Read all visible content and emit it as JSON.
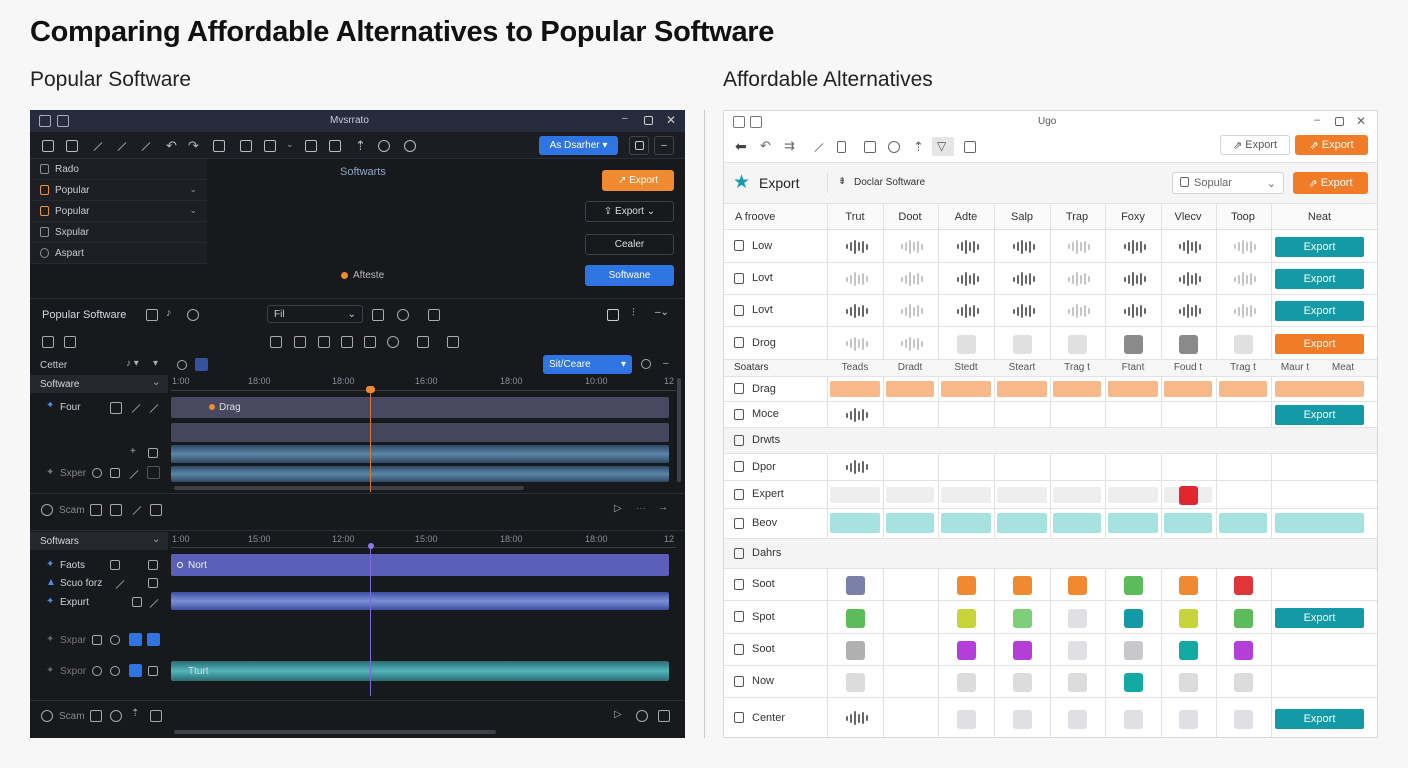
{
  "title": "Comparing Affordable Alternatives to Popular Software",
  "left_heading": "Popular Software",
  "right_heading": "Affordable Alternatives",
  "dark": {
    "window_title": "Mvsrrato",
    "toolbar_button": "As Dsarher",
    "menu": [
      "Rado",
      "Popular",
      "Popular",
      "Sxpular",
      "Aspart"
    ],
    "canvas_label": "Softwarts",
    "export1": "Export",
    "export2": "Export",
    "creater": "Cealer",
    "status_label": "Afteste",
    "software_btn": "Softwane",
    "panel1": {
      "title": "Popular Software",
      "select": "Fil",
      "track_label": "Cetter",
      "track_header": "Software",
      "preset": "Sit/Ceare",
      "ticks": [
        "1:00",
        "18:00",
        "18:00",
        "16:00",
        "18:00",
        "10:00",
        "12"
      ],
      "tracks": [
        "Four",
        "Sxper"
      ],
      "clip": "Drag",
      "footer": "Scam"
    },
    "panel2": {
      "track_header": "Softwars",
      "ticks": [
        "1:00",
        "15:00",
        "12:00",
        "15:00",
        "18:00",
        "18:00",
        "12"
      ],
      "tracks": [
        "Faots",
        "Scuo forz",
        "Expurt",
        "Sxpar",
        "Sxpor"
      ],
      "clip": "Nort",
      "clip2": "Tturt",
      "footer": "Scam"
    }
  },
  "light": {
    "window_title": "Ugo",
    "export_outline": "Export",
    "export_orange": "Export",
    "app_name": "Export",
    "tab": "Doclar Software",
    "select": "Sopular",
    "export_btn2": "Export",
    "columns": [
      "A froove",
      "Trut",
      "Doot",
      "Adte",
      "Salp",
      "Trap",
      "Foxy",
      "Vlecv",
      "Toop",
      "Neat"
    ],
    "rows1": [
      "Low",
      "Lovt",
      "Lovt",
      "Drog"
    ],
    "section_label": "Soatars",
    "section_cols": [
      "Teads",
      "Dradt",
      "Stedt",
      "Steart",
      "Trag t",
      "Ftant",
      "Foud t",
      "Trag t",
      "Maur t",
      "Meat"
    ],
    "rows2": [
      "Drag",
      "Moce",
      "Drwts",
      "Dpor",
      "Expert",
      "Beov",
      "Dahrs",
      "Soot",
      "Spot",
      "Soot",
      "Now",
      "Center"
    ],
    "export_label": "Export",
    "colors": {
      "teal": "#139aa6",
      "orange": "#f07c28",
      "peach": "#f8b98a",
      "aqua": "#a6e2df"
    }
  }
}
